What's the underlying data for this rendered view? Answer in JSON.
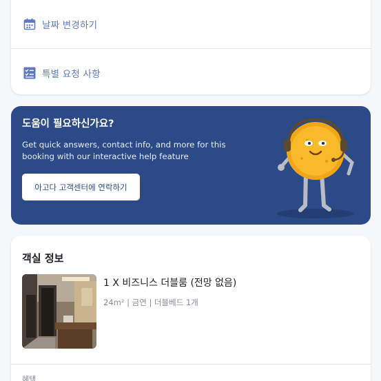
{
  "options": [
    {
      "label": "날짜 변경하기",
      "icon": "calendar-icon"
    },
    {
      "label": "특별 요청 사항",
      "icon": "checklist-icon"
    }
  ],
  "help": {
    "title": "도움이 필요하신가요?",
    "description": "Get quick answers, contact info, and more for this booking with our interactive help feature",
    "button_label": "아고다 고객센터에 연락하기",
    "mascot_icon": "support-mascot-icon",
    "background_color": "#2b4a87"
  },
  "room": {
    "heading": "객실 정보",
    "name": "1 X 비즈니스 더블룸 (전망 없음)",
    "meta": "24m² | 금연 | 더블베드 1개",
    "next_section_label": "혜택"
  },
  "colors": {
    "accent": "#5e7ac4",
    "banner": "#2b4a87"
  }
}
